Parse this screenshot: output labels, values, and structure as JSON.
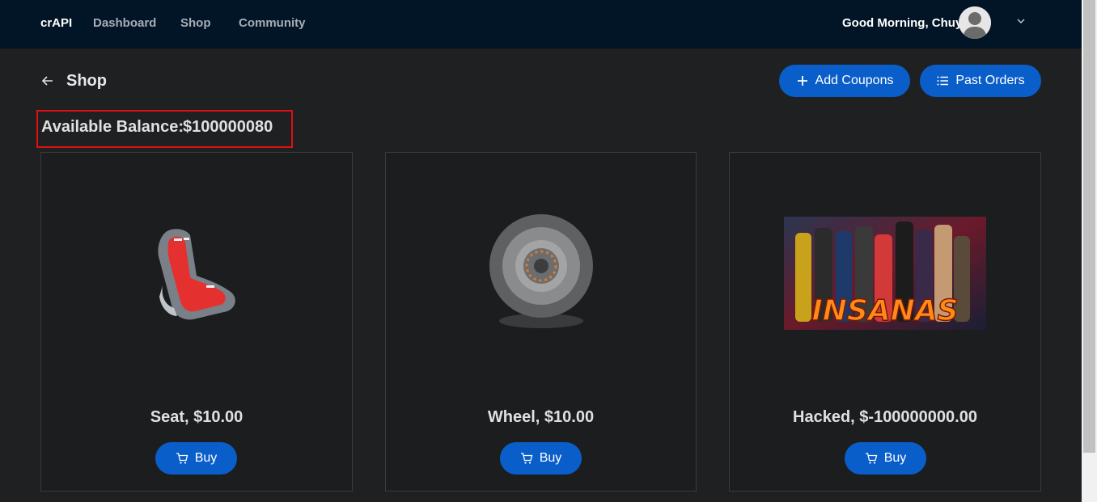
{
  "header": {
    "brand": "crAPI",
    "nav": [
      "Dashboard",
      "Shop",
      "Community"
    ],
    "greeting": "Good Morning, Chuy!"
  },
  "page": {
    "title": "Shop",
    "add_coupons_label": "Add Coupons",
    "past_orders_label": "Past Orders",
    "balance_label": "Available Balance:",
    "balance_value": "$100000080"
  },
  "products": [
    {
      "title": "Seat, $10.00",
      "buy_label": "Buy",
      "image": "seat-image"
    },
    {
      "title": "Wheel, $10.00",
      "buy_label": "Buy",
      "image": "wheel-image"
    },
    {
      "title": "Hacked, $-100000000.00",
      "buy_label": "Buy",
      "image": "hacked-banner-image",
      "banner_text": "INSANAS"
    }
  ],
  "colors": {
    "topbar": "#021527",
    "background": "#1f2022",
    "primary_button": "#0a5ec9",
    "highlight_box": "#e01010"
  }
}
